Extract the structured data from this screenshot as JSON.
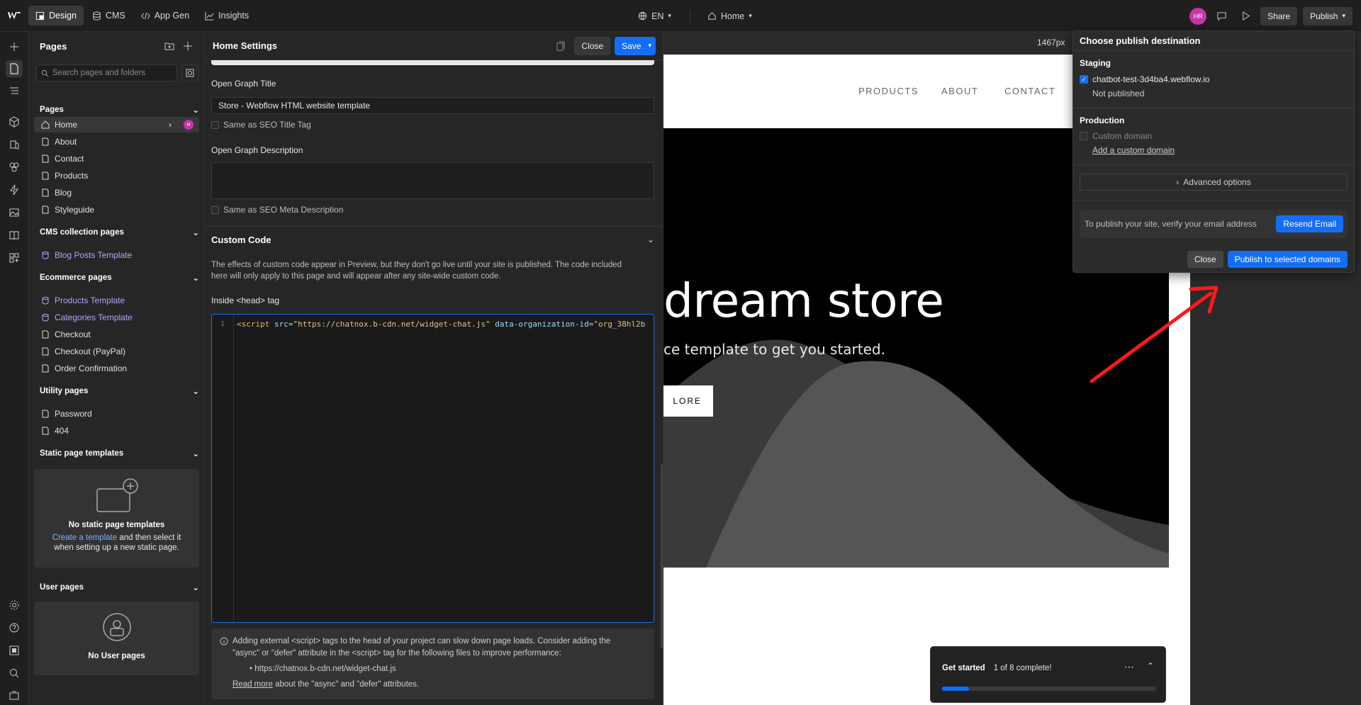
{
  "topbar": {
    "modes": [
      {
        "label": "Design",
        "icon": "design-icon",
        "active": true
      },
      {
        "label": "CMS",
        "icon": "database-icon",
        "active": false
      },
      {
        "label": "App Gen",
        "icon": "code-icon",
        "active": false
      },
      {
        "label": "Insights",
        "icon": "chart-icon",
        "active": false
      }
    ],
    "locale": "EN",
    "page": "Home",
    "avatar": "HR",
    "share": "Share",
    "publish": "Publish"
  },
  "pages_panel": {
    "title": "Pages",
    "search_placeholder": "Search pages and folders",
    "sections": {
      "pages": "Pages",
      "cms": "CMS collection pages",
      "ecommerce": "Ecommerce pages",
      "utility": "Utility pages",
      "static": "Static page templates",
      "user": "User pages"
    },
    "pages": [
      "Home",
      "About",
      "Contact",
      "Products",
      "Blog",
      "Styleguide"
    ],
    "home_badge": "H",
    "cms_pages": [
      "Blog Posts Template"
    ],
    "ecommerce_pages": [
      "Products Template",
      "Categories Template",
      "Checkout",
      "Checkout (PayPal)",
      "Order Confirmation"
    ],
    "utility_pages": [
      "Password",
      "404"
    ],
    "static_empty": {
      "title": "No static page templates",
      "link": "Create a template",
      "text1": "and then select it",
      "text2": "when setting up a new static page."
    },
    "user_empty": "No User pages"
  },
  "settings": {
    "title": "Home Settings",
    "close": "Close",
    "save": "Save",
    "og_title_label": "Open Graph Title",
    "og_title_value": "Store - Webflow HTML website template",
    "same_seo_title": "Same as SEO Title Tag",
    "og_desc_label": "Open Graph Description",
    "same_seo_desc": "Same as SEO Meta Description",
    "custom_code_title": "Custom Code",
    "custom_code_desc1": "The effects of custom code appear in Preview, but they don't go live until your site is published. The code included",
    "custom_code_desc2": "here will only apply to this page and will appear after any site-wide custom code.",
    "head_label": "Inside <head> tag",
    "line_no": "1",
    "code_tag_open": "<script",
    "code_attr1": " src=",
    "code_val1": "\"https://chatnox.b-cdn.net/widget-chat.js\"",
    "code_attr2": " data-organization-id=",
    "code_val2": "\"org_38hl2b",
    "warning_line1": "Adding external <script> tags to the head of your project can slow down page loads. Consider adding the",
    "warning_line2": "\"async\" or \"defer\" attribute in the <script> tag for the following files to improve performance:",
    "warning_file": "https://chatnox.b-cdn.net/widget-chat.js",
    "read_more": "Read more",
    "read_more_rest": "about the \"async\" and \"defer\" attributes."
  },
  "canvas": {
    "width_label": "1467px",
    "nav": [
      "PRODUCTS",
      "ABOUT",
      "CONTACT"
    ],
    "hero_title": "dream store",
    "hero_sub": "ce template to get you started.",
    "cta": "LORE",
    "get_started": "Get started",
    "progress_text": "1 of 8 complete!",
    "progress_fraction": 0.125
  },
  "publish_popover": {
    "title": "Choose publish destination",
    "staging": "Staging",
    "staging_domain": "chatbot-test-3d4ba4.webflow.io",
    "staging_status": "Not published",
    "production": "Production",
    "custom_domain": "Custom domain",
    "add_custom_domain": "Add a custom domain",
    "advanced": "Advanced options",
    "verify_text": "To publish your site, verify your email address",
    "resend": "Resend Email",
    "close": "Close",
    "publish_selected": "Publish to selected domains"
  },
  "colors": {
    "accent": "#146ef5",
    "annotation_arrow": "#ff1a1a",
    "cms_purple": "#b3a3ff"
  }
}
